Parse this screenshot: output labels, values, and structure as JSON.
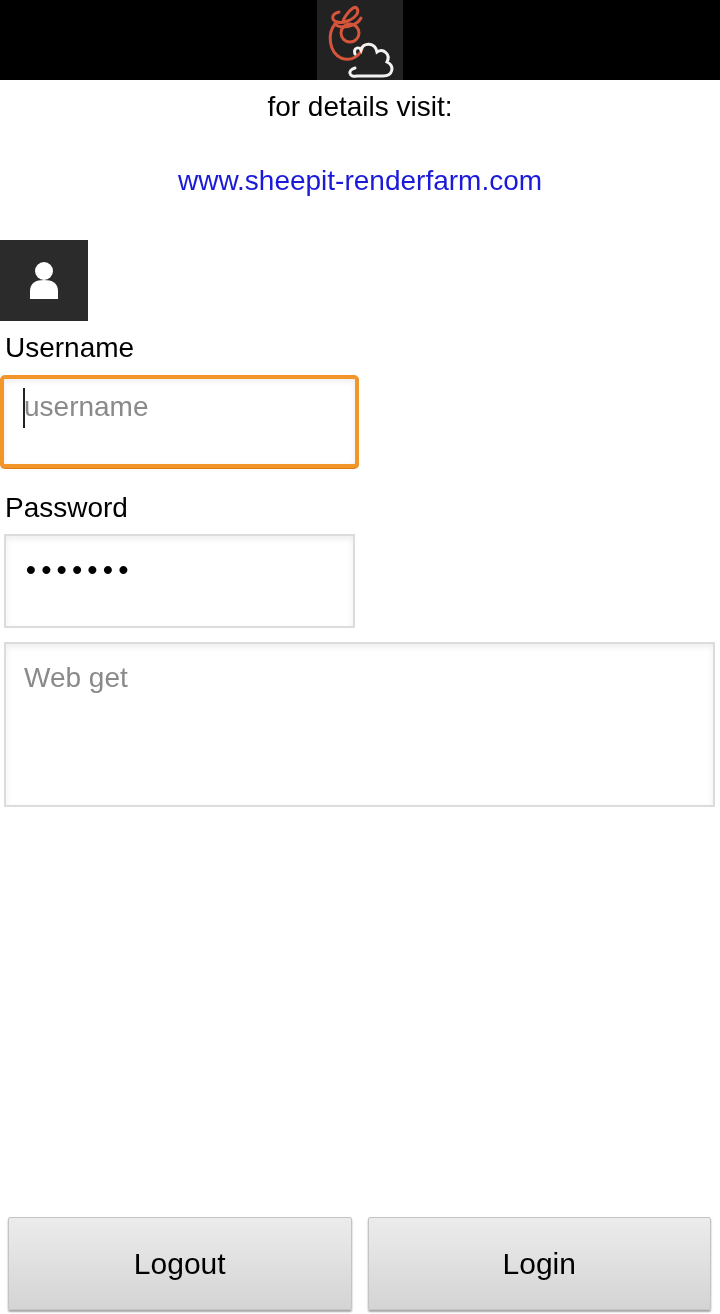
{
  "info": {
    "text": "for details visit:",
    "link": "www.sheepit-renderfarm.com"
  },
  "form": {
    "username": {
      "label": "Username",
      "placeholder": "username",
      "focused": true
    },
    "password": {
      "label": "Password",
      "value": "•••••••",
      "focused": false
    },
    "web_get": {
      "placeholder": "Web get",
      "focused": false
    }
  },
  "buttons": [
    {
      "label": "Logout"
    },
    {
      "label": "Login"
    }
  ]
}
